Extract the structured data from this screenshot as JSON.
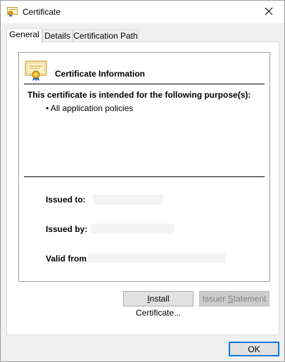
{
  "window": {
    "title": "Certificate",
    "icon": "certificate-icon",
    "close_glyph": "✕"
  },
  "tabs": [
    {
      "label": "General",
      "active": true
    },
    {
      "label": "Details",
      "active": false
    },
    {
      "label": "Certification Path",
      "active": false
    }
  ],
  "general": {
    "heading": "Certificate Information",
    "purpose_heading": "This certificate is intended for the following purpose(s):",
    "purposes": [
      "• All application policies"
    ],
    "issued_to_label": "Issued to:",
    "issued_to_value": "",
    "issued_by_label": "Issued by:",
    "issued_by_value": "",
    "valid_from_label": "Valid from",
    "valid_from_value": ""
  },
  "buttons": {
    "install_certificate_prefix": "I",
    "install_certificate_rest": "nstall Certificate...",
    "issuer_statement_prefix": "Issuer ",
    "issuer_statement_access": "S",
    "issuer_statement_rest": "tatement",
    "ok": "OK"
  },
  "colors": {
    "accent": "#0078d7",
    "panel": "#ffffff",
    "chrome": "#f0f0f0"
  }
}
